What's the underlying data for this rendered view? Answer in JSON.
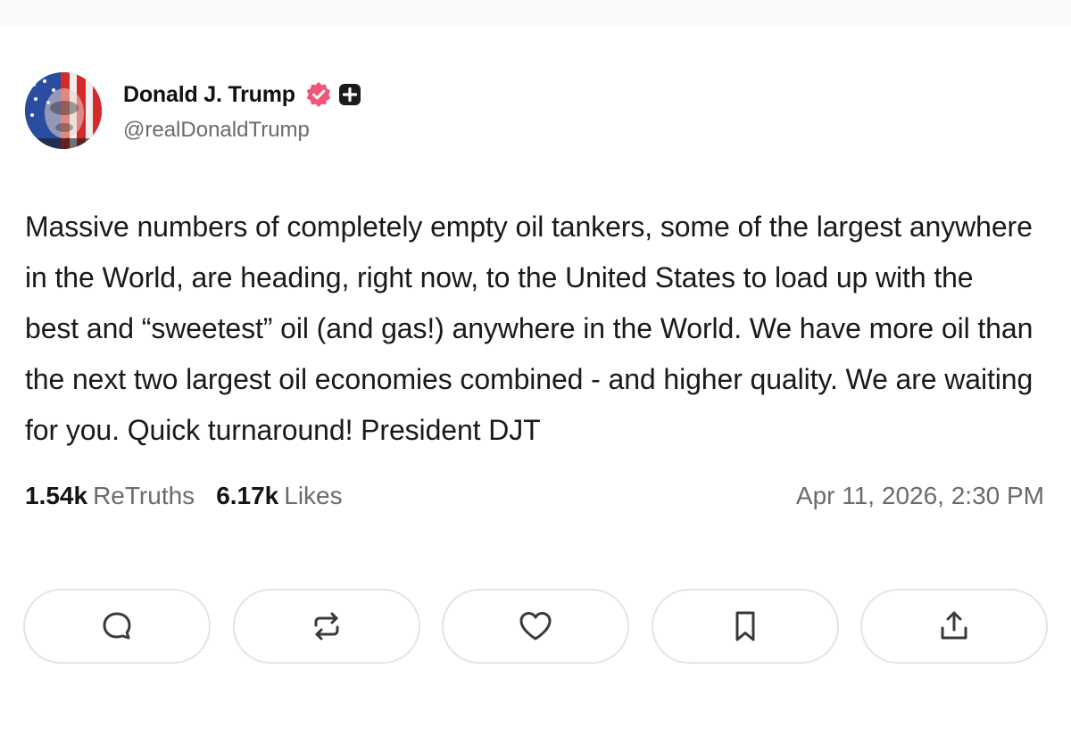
{
  "post": {
    "author": {
      "display_name": "Donald J. Trump",
      "handle": "@realDonaldTrump",
      "verified_badge_icon": "verified-check-icon",
      "plus_badge_icon": "plus-square-icon"
    },
    "text": "Massive numbers of completely empty oil tankers, some of the largest anywhere in the World, are heading, right now, to the United States to load up with the best and “sweetest” oil (and gas!) anywhere in the World. We have more oil than the next two largest oil economies combined - and higher quality. We are waiting for you. Quick turnaround! President DJT",
    "stats": {
      "retruths_count": "1.54k",
      "retruths_label": "ReTruths",
      "likes_count": "6.17k",
      "likes_label": "Likes"
    },
    "timestamp": "Apr 11, 2026, 2:30 PM"
  },
  "actions": [
    {
      "name": "reply",
      "icon": "comment-icon"
    },
    {
      "name": "retruth",
      "icon": "repost-icon"
    },
    {
      "name": "like",
      "icon": "heart-icon"
    },
    {
      "name": "bookmark",
      "icon": "bookmark-icon"
    },
    {
      "name": "share",
      "icon": "share-icon"
    }
  ],
  "colors": {
    "verified_badge": "#f0557a",
    "text_primary": "#1a1a1a",
    "text_secondary": "#6b6b6b",
    "button_border": "#e4e4e4"
  }
}
